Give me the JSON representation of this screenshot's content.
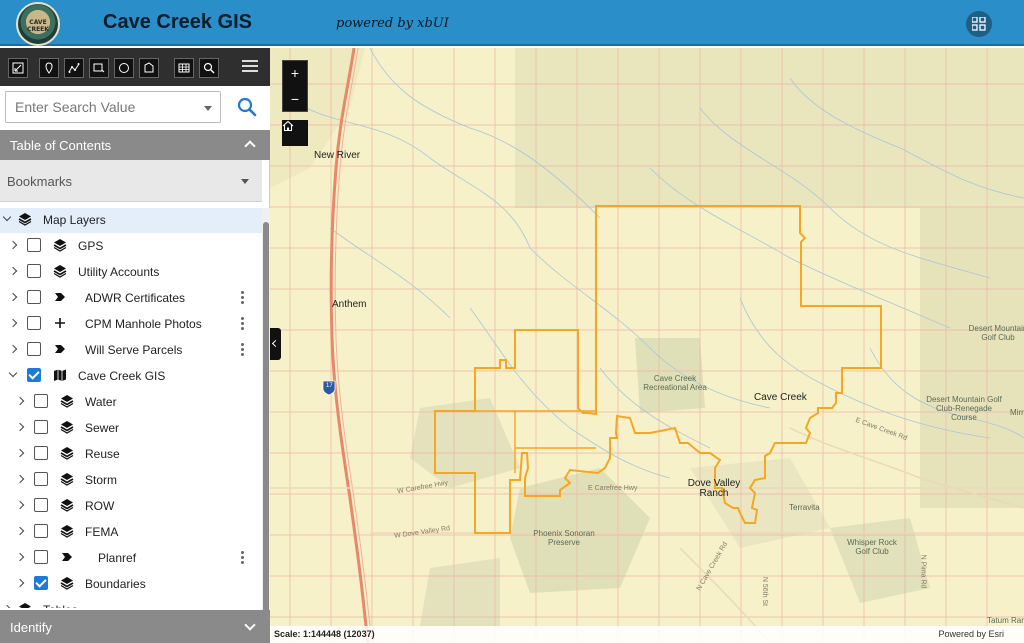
{
  "header": {
    "logo_text": "CAVE CREEK",
    "title": "Cave Creek GIS",
    "powered_by": "powered by xbUI",
    "apps_icon": "grid-icon"
  },
  "toolbar": {
    "tools": [
      "measure-icon",
      "point-icon",
      "polyline-icon",
      "rectangle-icon",
      "circle-icon",
      "polygon-icon",
      "table-icon",
      "search-icon"
    ],
    "menu_icon": "hamburger-icon"
  },
  "search": {
    "placeholder": "Enter Search Value",
    "value": ""
  },
  "toc": {
    "title": "Table of Contents",
    "bookmarks_label": "Bookmarks",
    "items": [
      {
        "label": "Map Layers",
        "level": 0,
        "expanded": true,
        "checkbox": false,
        "icon": "layers-icon",
        "selected": true
      },
      {
        "label": "GPS",
        "level": 1,
        "expanded": false,
        "checkbox": true,
        "checked": false,
        "icon": "layers-icon"
      },
      {
        "label": "Utility Accounts",
        "level": 1,
        "expanded": false,
        "checkbox": true,
        "checked": false,
        "icon": "layers-icon"
      },
      {
        "label": "ADWR Certificates",
        "level": 1,
        "expanded": false,
        "checkbox": true,
        "checked": false,
        "icon": "chevron-symbol-icon",
        "menu": true
      },
      {
        "label": "CPM Manhole Photos",
        "level": 1,
        "expanded": false,
        "checkbox": true,
        "checked": false,
        "icon": "plus-symbol-icon",
        "menu": true
      },
      {
        "label": "Will Serve Parcels",
        "level": 1,
        "expanded": false,
        "checkbox": true,
        "checked": false,
        "icon": "chevron-symbol-icon",
        "menu": true
      },
      {
        "label": "Cave Creek GIS",
        "level": 1,
        "expanded": true,
        "checkbox": true,
        "checked": true,
        "icon": "map-icon"
      },
      {
        "label": "Water",
        "level": 2,
        "expanded": false,
        "checkbox": true,
        "checked": false,
        "icon": "layers-icon"
      },
      {
        "label": "Sewer",
        "level": 2,
        "expanded": false,
        "checkbox": true,
        "checked": false,
        "icon": "layers-icon"
      },
      {
        "label": "Reuse",
        "level": 2,
        "expanded": false,
        "checkbox": true,
        "checked": false,
        "icon": "layers-icon"
      },
      {
        "label": "Storm",
        "level": 2,
        "expanded": false,
        "checkbox": true,
        "checked": false,
        "icon": "layers-icon"
      },
      {
        "label": "ROW",
        "level": 2,
        "expanded": false,
        "checkbox": true,
        "checked": false,
        "icon": "layers-icon"
      },
      {
        "label": "FEMA",
        "level": 2,
        "expanded": false,
        "checkbox": true,
        "checked": false,
        "icon": "layers-icon"
      },
      {
        "label": "Planref",
        "level": 2,
        "expanded": false,
        "checkbox": true,
        "checked": false,
        "icon": "chevron-symbol-icon",
        "menu": true
      },
      {
        "label": "Boundaries",
        "level": 2,
        "expanded": false,
        "checkbox": true,
        "checked": true,
        "icon": "layers-icon"
      },
      {
        "label": "Tables",
        "level": 0,
        "expanded": false,
        "checkbox": false,
        "icon": "layers-icon"
      }
    ]
  },
  "identify": {
    "label": "Identify"
  },
  "map": {
    "zoom_in": "+",
    "zoom_out": "−",
    "home_icon": "home-icon",
    "places": [
      "New River",
      "Anthem",
      "Cave Creek Recreational Area",
      "Cave Creek",
      "Dove Valley Ranch",
      "Terravita",
      "Phoenix Sonoran Preserve",
      "Whisper Rock Golf Club",
      "Desert Mountain Golf Club",
      "Desert Mountain Golf Club-Renegade Course",
      "Mirr",
      "Tatum Ranch"
    ],
    "roads": [
      "W Carefree Hwy",
      "E Carefree Hwy",
      "W Dove Valley Rd",
      "E Cave Creek Rd",
      "N Cave Creek Rd",
      "N 56th St",
      "N Pima Rd"
    ],
    "highway_shield": "17",
    "scale": "Scale: 1:144448 (12037)",
    "attribution": "Powered by Esri",
    "colors": {
      "base": "#f6f1c8",
      "boundary": "#f5a623",
      "grid": "#efb2a8",
      "hydro": "#a9c6d9",
      "parks": "#dfe0b8",
      "highway": "#e8886a"
    }
  }
}
